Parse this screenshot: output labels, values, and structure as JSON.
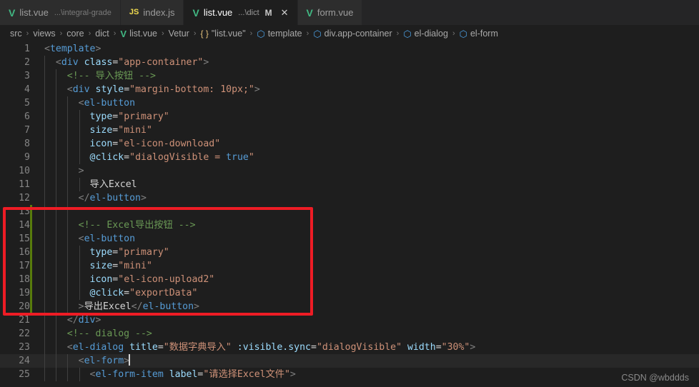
{
  "tabs": [
    {
      "icon": "vue-icon",
      "glyph": "V",
      "label": "list.vue",
      "desc": "...\\integral-grade",
      "dirty": "",
      "active": false,
      "closable": false
    },
    {
      "icon": "js-icon",
      "glyph": "JS",
      "label": "index.js",
      "desc": "",
      "dirty": "",
      "active": false,
      "closable": false
    },
    {
      "icon": "vue-icon",
      "glyph": "V",
      "label": "list.vue",
      "desc": "...\\dict",
      "dirty": "M",
      "active": true,
      "closable": true,
      "close_glyph": "✕"
    },
    {
      "icon": "vue-icon",
      "glyph": "V",
      "label": "form.vue",
      "desc": "",
      "dirty": "",
      "active": false,
      "closable": false
    }
  ],
  "breadcrumb": {
    "separator": "›",
    "items": [
      {
        "icon": "",
        "glyph": "",
        "label": "src"
      },
      {
        "icon": "",
        "glyph": "",
        "label": "views"
      },
      {
        "icon": "",
        "glyph": "",
        "label": "core"
      },
      {
        "icon": "",
        "glyph": "",
        "label": "dict"
      },
      {
        "icon": "vue-icon",
        "glyph": "V",
        "label": "list.vue"
      },
      {
        "icon": "",
        "glyph": "",
        "label": "Vetur"
      },
      {
        "icon": "braces-icon",
        "glyph": "{ }",
        "label": "\"list.vue\""
      },
      {
        "icon": "cube-icon",
        "glyph": "⬡",
        "label": "template"
      },
      {
        "icon": "cube-icon",
        "glyph": "⬡",
        "label": "div.app-container"
      },
      {
        "icon": "cube-icon",
        "glyph": "⬡",
        "label": "el-dialog"
      },
      {
        "icon": "cube-icon",
        "glyph": "⬡",
        "label": "el-form"
      }
    ]
  },
  "editor": {
    "first_line": 1,
    "cursor_line": 24,
    "lines": [
      {
        "n": "1",
        "indent_guides": 0,
        "git": false,
        "tokens": [
          {
            "c": "punct",
            "t": "<"
          },
          {
            "c": "tag",
            "t": "template"
          },
          {
            "c": "punct",
            "t": ">"
          }
        ]
      },
      {
        "n": "2",
        "indent_guides": 1,
        "git": false,
        "tokens": [
          {
            "c": "txt",
            "t": "  "
          },
          {
            "c": "punct",
            "t": "<"
          },
          {
            "c": "tag",
            "t": "div"
          },
          {
            "c": "txt",
            "t": " "
          },
          {
            "c": "attr",
            "t": "class"
          },
          {
            "c": "eq",
            "t": "="
          },
          {
            "c": "str",
            "t": "\"app-container\""
          },
          {
            "c": "punct",
            "t": ">"
          }
        ]
      },
      {
        "n": "3",
        "indent_guides": 2,
        "git": false,
        "tokens": [
          {
            "c": "txt",
            "t": "    "
          },
          {
            "c": "cmt",
            "t": "<!-- 导入按钮 -->"
          }
        ]
      },
      {
        "n": "4",
        "indent_guides": 2,
        "git": false,
        "tokens": [
          {
            "c": "txt",
            "t": "    "
          },
          {
            "c": "punct",
            "t": "<"
          },
          {
            "c": "tag",
            "t": "div"
          },
          {
            "c": "txt",
            "t": " "
          },
          {
            "c": "attr",
            "t": "style"
          },
          {
            "c": "eq",
            "t": "="
          },
          {
            "c": "str",
            "t": "\"margin-bottom: 10px;\""
          },
          {
            "c": "punct",
            "t": ">"
          }
        ]
      },
      {
        "n": "5",
        "indent_guides": 3,
        "git": false,
        "tokens": [
          {
            "c": "txt",
            "t": "      "
          },
          {
            "c": "punct",
            "t": "<"
          },
          {
            "c": "tag",
            "t": "el-button"
          }
        ]
      },
      {
        "n": "6",
        "indent_guides": 4,
        "git": false,
        "tokens": [
          {
            "c": "txt",
            "t": "        "
          },
          {
            "c": "attr",
            "t": "type"
          },
          {
            "c": "eq",
            "t": "="
          },
          {
            "c": "str",
            "t": "\"primary\""
          }
        ]
      },
      {
        "n": "7",
        "indent_guides": 4,
        "git": false,
        "tokens": [
          {
            "c": "txt",
            "t": "        "
          },
          {
            "c": "attr",
            "t": "size"
          },
          {
            "c": "eq",
            "t": "="
          },
          {
            "c": "str",
            "t": "\"mini\""
          }
        ]
      },
      {
        "n": "8",
        "indent_guides": 4,
        "git": false,
        "tokens": [
          {
            "c": "txt",
            "t": "        "
          },
          {
            "c": "attr",
            "t": "icon"
          },
          {
            "c": "eq",
            "t": "="
          },
          {
            "c": "str",
            "t": "\"el-icon-download\""
          }
        ]
      },
      {
        "n": "9",
        "indent_guides": 4,
        "git": false,
        "tokens": [
          {
            "c": "txt",
            "t": "        "
          },
          {
            "c": "attr",
            "t": "@click"
          },
          {
            "c": "eq",
            "t": "="
          },
          {
            "c": "str",
            "t": "\"dialogVisible = "
          },
          {
            "c": "kw",
            "t": "true"
          },
          {
            "c": "str",
            "t": "\""
          }
        ]
      },
      {
        "n": "10",
        "indent_guides": 3,
        "git": false,
        "tokens": [
          {
            "c": "txt",
            "t": "      "
          },
          {
            "c": "punct",
            "t": ">"
          }
        ]
      },
      {
        "n": "11",
        "indent_guides": 4,
        "git": false,
        "tokens": [
          {
            "c": "txt",
            "t": "        "
          },
          {
            "c": "txt",
            "t": "导入Excel"
          }
        ]
      },
      {
        "n": "12",
        "indent_guides": 3,
        "git": false,
        "tokens": [
          {
            "c": "txt",
            "t": "      "
          },
          {
            "c": "punct",
            "t": "</"
          },
          {
            "c": "tag",
            "t": "el-button"
          },
          {
            "c": "punct",
            "t": ">"
          }
        ]
      },
      {
        "n": "13",
        "indent_guides": 3,
        "git": true,
        "tokens": []
      },
      {
        "n": "14",
        "indent_guides": 3,
        "git": true,
        "tokens": [
          {
            "c": "txt",
            "t": "      "
          },
          {
            "c": "cmt",
            "t": "<!-- Excel导出按钮 -->"
          }
        ]
      },
      {
        "n": "15",
        "indent_guides": 3,
        "git": true,
        "tokens": [
          {
            "c": "txt",
            "t": "      "
          },
          {
            "c": "punct",
            "t": "<"
          },
          {
            "c": "tag",
            "t": "el-button"
          }
        ]
      },
      {
        "n": "16",
        "indent_guides": 4,
        "git": true,
        "tokens": [
          {
            "c": "txt",
            "t": "        "
          },
          {
            "c": "attr",
            "t": "type"
          },
          {
            "c": "eq",
            "t": "="
          },
          {
            "c": "str",
            "t": "\"primary\""
          }
        ]
      },
      {
        "n": "17",
        "indent_guides": 4,
        "git": true,
        "tokens": [
          {
            "c": "txt",
            "t": "        "
          },
          {
            "c": "attr",
            "t": "size"
          },
          {
            "c": "eq",
            "t": "="
          },
          {
            "c": "str",
            "t": "\"mini\""
          }
        ]
      },
      {
        "n": "18",
        "indent_guides": 4,
        "git": true,
        "tokens": [
          {
            "c": "txt",
            "t": "        "
          },
          {
            "c": "attr",
            "t": "icon"
          },
          {
            "c": "eq",
            "t": "="
          },
          {
            "c": "str",
            "t": "\"el-icon-upload2\""
          }
        ]
      },
      {
        "n": "19",
        "indent_guides": 4,
        "git": true,
        "tokens": [
          {
            "c": "txt",
            "t": "        "
          },
          {
            "c": "attr",
            "t": "@click"
          },
          {
            "c": "eq",
            "t": "="
          },
          {
            "c": "str",
            "t": "\"exportData\""
          }
        ]
      },
      {
        "n": "20",
        "indent_guides": 3,
        "git": true,
        "tokens": [
          {
            "c": "txt",
            "t": "      "
          },
          {
            "c": "punct",
            "t": ">"
          },
          {
            "c": "txt",
            "t": "导出Excel"
          },
          {
            "c": "punct",
            "t": "</"
          },
          {
            "c": "tag",
            "t": "el-button"
          },
          {
            "c": "punct",
            "t": ">"
          }
        ]
      },
      {
        "n": "21",
        "indent_guides": 2,
        "git": false,
        "tokens": [
          {
            "c": "txt",
            "t": "    "
          },
          {
            "c": "punct",
            "t": "</"
          },
          {
            "c": "tag",
            "t": "div"
          },
          {
            "c": "punct",
            "t": ">"
          }
        ]
      },
      {
        "n": "22",
        "indent_guides": 2,
        "git": false,
        "tokens": [
          {
            "c": "txt",
            "t": "    "
          },
          {
            "c": "cmt",
            "t": "<!-- dialog -->"
          }
        ]
      },
      {
        "n": "23",
        "indent_guides": 2,
        "git": false,
        "tokens": [
          {
            "c": "txt",
            "t": "    "
          },
          {
            "c": "punct",
            "t": "<"
          },
          {
            "c": "tag",
            "t": "el-dialog"
          },
          {
            "c": "txt",
            "t": " "
          },
          {
            "c": "attr",
            "t": "title"
          },
          {
            "c": "eq",
            "t": "="
          },
          {
            "c": "str",
            "t": "\"数据字典导入\""
          },
          {
            "c": "txt",
            "t": " "
          },
          {
            "c": "attr",
            "t": ":visible.sync"
          },
          {
            "c": "eq",
            "t": "="
          },
          {
            "c": "str",
            "t": "\"dialogVisible\""
          },
          {
            "c": "txt",
            "t": " "
          },
          {
            "c": "attr",
            "t": "width"
          },
          {
            "c": "eq",
            "t": "="
          },
          {
            "c": "str",
            "t": "\"30%\""
          },
          {
            "c": "punct",
            "t": ">"
          }
        ]
      },
      {
        "n": "24",
        "indent_guides": 3,
        "git": false,
        "current": true,
        "caret": true,
        "tokens": [
          {
            "c": "txt",
            "t": "      "
          },
          {
            "c": "punct",
            "t": "<"
          },
          {
            "c": "tag",
            "t": "el-form"
          },
          {
            "c": "punct",
            "t": ">"
          }
        ]
      },
      {
        "n": "25",
        "indent_guides": 4,
        "git": false,
        "tokens": [
          {
            "c": "txt",
            "t": "        "
          },
          {
            "c": "punct",
            "t": "<"
          },
          {
            "c": "tag",
            "t": "el-form-item"
          },
          {
            "c": "txt",
            "t": " "
          },
          {
            "c": "attr",
            "t": "label"
          },
          {
            "c": "eq",
            "t": "="
          },
          {
            "c": "str",
            "t": "\"请选择Excel文件\""
          },
          {
            "c": "punct",
            "t": ">"
          }
        ]
      }
    ]
  },
  "annotation": {
    "name": "red-highlight-box",
    "color": "#ee1c25",
    "covers_lines": "13-20"
  },
  "watermark": {
    "text": "CSDN @wbddds"
  },
  "colors": {
    "editor_bg": "#1e1e1e",
    "tab_inactive_bg": "#2d2d2d",
    "tab_active_bg": "#1e1e1e",
    "tabbar_bg": "#252526",
    "git_modified": "#587c0c",
    "annotation_red": "#ee1c25"
  }
}
